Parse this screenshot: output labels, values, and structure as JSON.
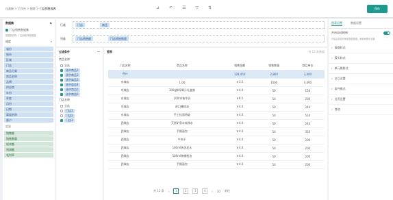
{
  "topbar": {
    "breadcrumb": [
      "仪表板",
      "工作台",
      "报表",
      "门店销售报表"
    ],
    "tools": [
      "⊿",
      "↶",
      "☰",
      "▽",
      "⇅"
    ],
    "primary": "保存"
  },
  "left": {
    "title": "数据集",
    "dataset": "门店销售数据集",
    "dataset_desc": "数据集说明：门店销售明细数据",
    "fields_head": "维度",
    "dims": [
      "省份",
      "城市",
      "区域",
      "门店",
      "商品分类",
      "商品名称",
      "品牌",
      "供应商",
      "年份",
      "季度",
      "月份",
      "日期",
      "渠道名称",
      "客户"
    ],
    "measures_head": "度量",
    "measures": [
      "销售额",
      "销售数量",
      "成本额",
      "利润额",
      "毛利率"
    ]
  },
  "cond": {
    "row_label": "行维",
    "row_chips": [
      "门店",
      "商品"
    ],
    "col_label": "列维",
    "col_chips": [
      "门店销售额",
      "门店销售数量"
    ]
  },
  "fpanel": {
    "title": "过滤条件",
    "s1": "商品名称",
    "s1_items": [
      "全选",
      "选中商品1",
      "选中商品2",
      "选中商品3",
      "选中商品4",
      "选中商品5",
      "选中商品6"
    ],
    "s2": "门店名称",
    "s2_items": [
      "全选",
      "门店1",
      "门店2",
      "门店3"
    ]
  },
  "table": {
    "title": "报表",
    "subtitle": "共 12 条数据",
    "columns": [
      "门店名称",
      "商品名称",
      "销售金额",
      "销售数量",
      "商品单价"
    ],
    "total": [
      "合计",
      "",
      "128,450",
      "2,860",
      "3,400"
    ],
    "rows": [
      [
        "东城店",
        "1.00",
        "￥3.5",
        "1000",
        "3,400"
      ],
      [
        "东城店",
        "300g鲜榨果汁礼盒装",
        "￥4.0",
        "50",
        "150"
      ],
      [
        "东城店",
        "200ml装牛奶",
        "￥6.5",
        "50",
        "200"
      ],
      [
        "东城店",
        "进口橄榄油",
        "￥4.0",
        "50",
        "240"
      ],
      [
        "东城店",
        "手工挂面特级",
        "￥4.0",
        "50",
        "510"
      ],
      [
        "西城店",
        "天然矿泉水纯净水",
        "￥4.0",
        "50",
        "240"
      ],
      [
        "西城店",
        "手撕面包",
        "￥4.0",
        "50",
        "350"
      ],
      [
        "西城店",
        "牛肉干",
        "￥4.0",
        "50",
        "200"
      ],
      [
        "西城店",
        "100ml装洗发水",
        "￥4.0",
        "50",
        "200"
      ],
      [
        "西城店",
        "500ml装橄榄油",
        "￥4.0",
        "50",
        "200"
      ],
      [
        "西城店",
        "手撕面包",
        "￥4.0",
        "50",
        "200"
      ]
    ],
    "pager": {
      "info": "共 12 条",
      "pages": [
        "1",
        "2",
        "3",
        "4"
      ],
      "size": "10",
      "goto": "前往"
    }
  },
  "right": {
    "tab1": "图表设置",
    "tab2": "数据设置",
    "toggle_label": "开启自动刷新",
    "toggle_note": "开启后将定时刷新报表数据，刷新间隔可设置",
    "sections": [
      "表格样式",
      "表头样式",
      "单元格样式",
      "交互设置",
      "条件格式",
      "分页设置",
      "其他"
    ]
  }
}
